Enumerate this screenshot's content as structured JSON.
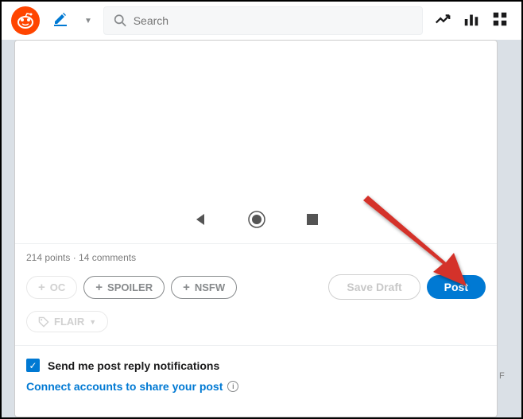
{
  "header": {
    "search_placeholder": "Search"
  },
  "post": {
    "stats": "214 points · 14 comments",
    "tags": {
      "oc": "OC",
      "spoiler": "SPOILER",
      "nsfw": "NSFW",
      "flair": "FLAIR"
    },
    "buttons": {
      "save_draft": "Save Draft",
      "post": "Post"
    },
    "notifications": {
      "reply_label": "Send me post reply notifications",
      "connect_label": "Connect accounts to share your post"
    }
  },
  "side_char": "F"
}
